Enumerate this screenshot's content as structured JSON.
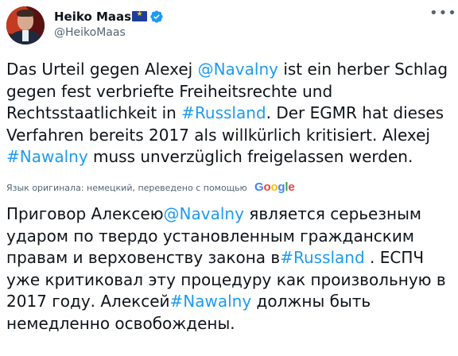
{
  "tweet": {
    "author": {
      "name": "Heiko Maas",
      "handle": "@HeikoMaas",
      "badge_icon": "eu-flag-icon",
      "verified_icon": "verified-badge-icon"
    },
    "original_parts": [
      "Das Urteil gegen Alexej ",
      "@Navalny",
      " ist ein herber Schlag gegen fest verbriefte Freiheitsrechte und Rechtsstaatlichkeit in ",
      "#Russland",
      ". Der EGMR hat dieses Verfahren bereits 2017 als willkürlich kritisiert. Alexej ",
      "#Nawalny",
      " muss unverzüglich freigelassen werden."
    ],
    "translation_note": "Язык оригинала: немецкий, переведено с помощью",
    "translation_provider": {
      "letters": [
        "G",
        "o",
        "o",
        "g",
        "l",
        "e"
      ],
      "colors": [
        "#4285f4",
        "#ea4335",
        "#fbbc05",
        "#4285f4",
        "#34a853",
        "#ea4335"
      ]
    },
    "translated_parts": [
      "Приговор Алексею",
      "@Navalny",
      " является серьезным ударом по твердо установленным гражданским правам и верховенству закона в",
      "#Russland",
      " . ЕСПЧ уже критиковал эту процедуру как произвольную в 2017 году. Алексей",
      "#Nawalny",
      " должны быть немедленно освобождены."
    ]
  },
  "colors": {
    "link": "#1d9bf0",
    "text": "#0f1419",
    "secondary": "#536471",
    "verified": "#1d9bf0"
  }
}
